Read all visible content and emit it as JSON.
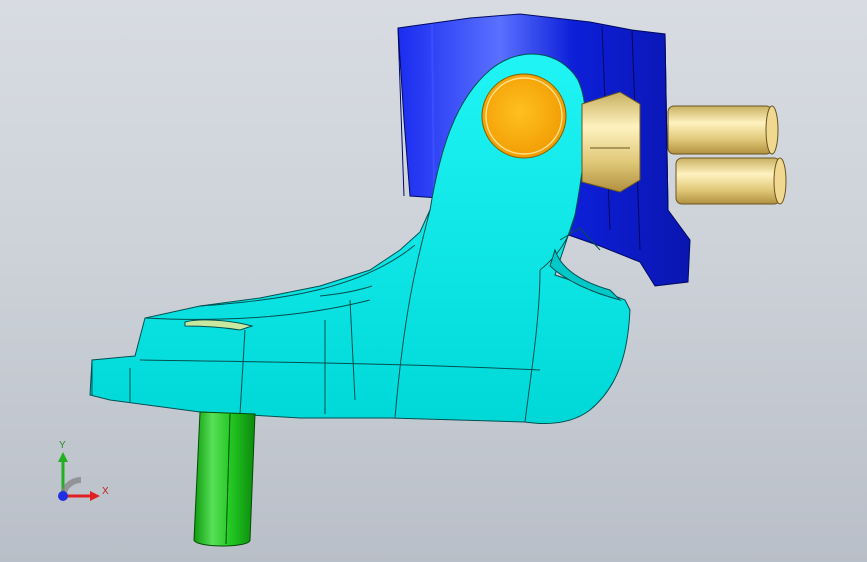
{
  "viewport": {
    "background_top": "#d8dce2",
    "background_bottom": "#b9bfc8"
  },
  "model": {
    "bracket_color": "#00e8e8",
    "mount_block_color": "#1020e0",
    "pivot_pin_color": "#f5a800",
    "bolt_color": "#e8d590",
    "shaft_color": "#22cc22"
  },
  "triad": {
    "x_label": "X",
    "y_label": "Y",
    "x_color": "#e02020",
    "y_color": "#20b020",
    "z_color": "#2030e0"
  }
}
